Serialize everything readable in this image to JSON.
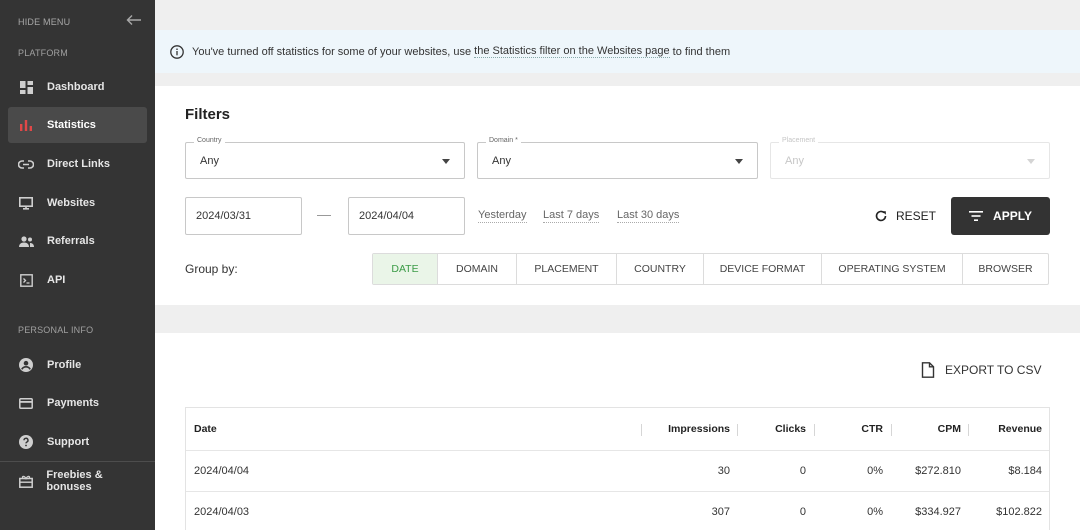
{
  "sidebar": {
    "hide_menu": "HIDE MENU",
    "section_platform": "PLATFORM",
    "section_personal": "PERSONAL INFO",
    "items": [
      {
        "label": "Dashboard",
        "icon": "dashboard-icon"
      },
      {
        "label": "Statistics",
        "icon": "bar-chart-icon",
        "active": true
      },
      {
        "label": "Direct Links",
        "icon": "link-icon"
      },
      {
        "label": "Websites",
        "icon": "monitor-icon"
      },
      {
        "label": "Referrals",
        "icon": "people-icon"
      },
      {
        "label": "API",
        "icon": "terminal-icon"
      },
      {
        "label": "Profile",
        "icon": "user-icon"
      },
      {
        "label": "Payments",
        "icon": "credit-card-icon"
      },
      {
        "label": "Support",
        "icon": "help-icon"
      },
      {
        "label": "Freebies & bonuses",
        "icon": "gift-icon"
      }
    ],
    "accent_color": "#e04848"
  },
  "notice": {
    "text_before": "You've turned off statistics for some of your websites, use ",
    "link_text": "the Statistics filter on the Websites page",
    "text_after": " to find them"
  },
  "filters": {
    "title": "Filters",
    "country": {
      "label": "Country",
      "value": "Any"
    },
    "domain": {
      "label": "Domain *",
      "value": "Any"
    },
    "placement": {
      "label": "Placement",
      "value": "Any"
    },
    "date_from": "2024/03/31",
    "date_to": "2024/04/04",
    "quick_ranges": [
      "Yesterday",
      "Last 7 days",
      "Last 30 days"
    ],
    "reset_label": "RESET",
    "apply_label": "APPLY",
    "group_by_label": "Group by:",
    "group_by_options": [
      "DATE",
      "DOMAIN",
      "PLACEMENT",
      "COUNTRY",
      "DEVICE FORMAT",
      "OPERATING SYSTEM",
      "BROWSER"
    ],
    "group_by_selected": "DATE"
  },
  "table": {
    "export_label": "EXPORT TO CSV",
    "columns": [
      "Date",
      "Impressions",
      "Clicks",
      "CTR",
      "CPM",
      "Revenue"
    ],
    "rows": [
      [
        "2024/04/04",
        "30",
        "0",
        "0%",
        "$272.810",
        "$8.184"
      ],
      [
        "2024/04/03",
        "307",
        "0",
        "0%",
        "$334.927",
        "$102.822"
      ]
    ]
  }
}
